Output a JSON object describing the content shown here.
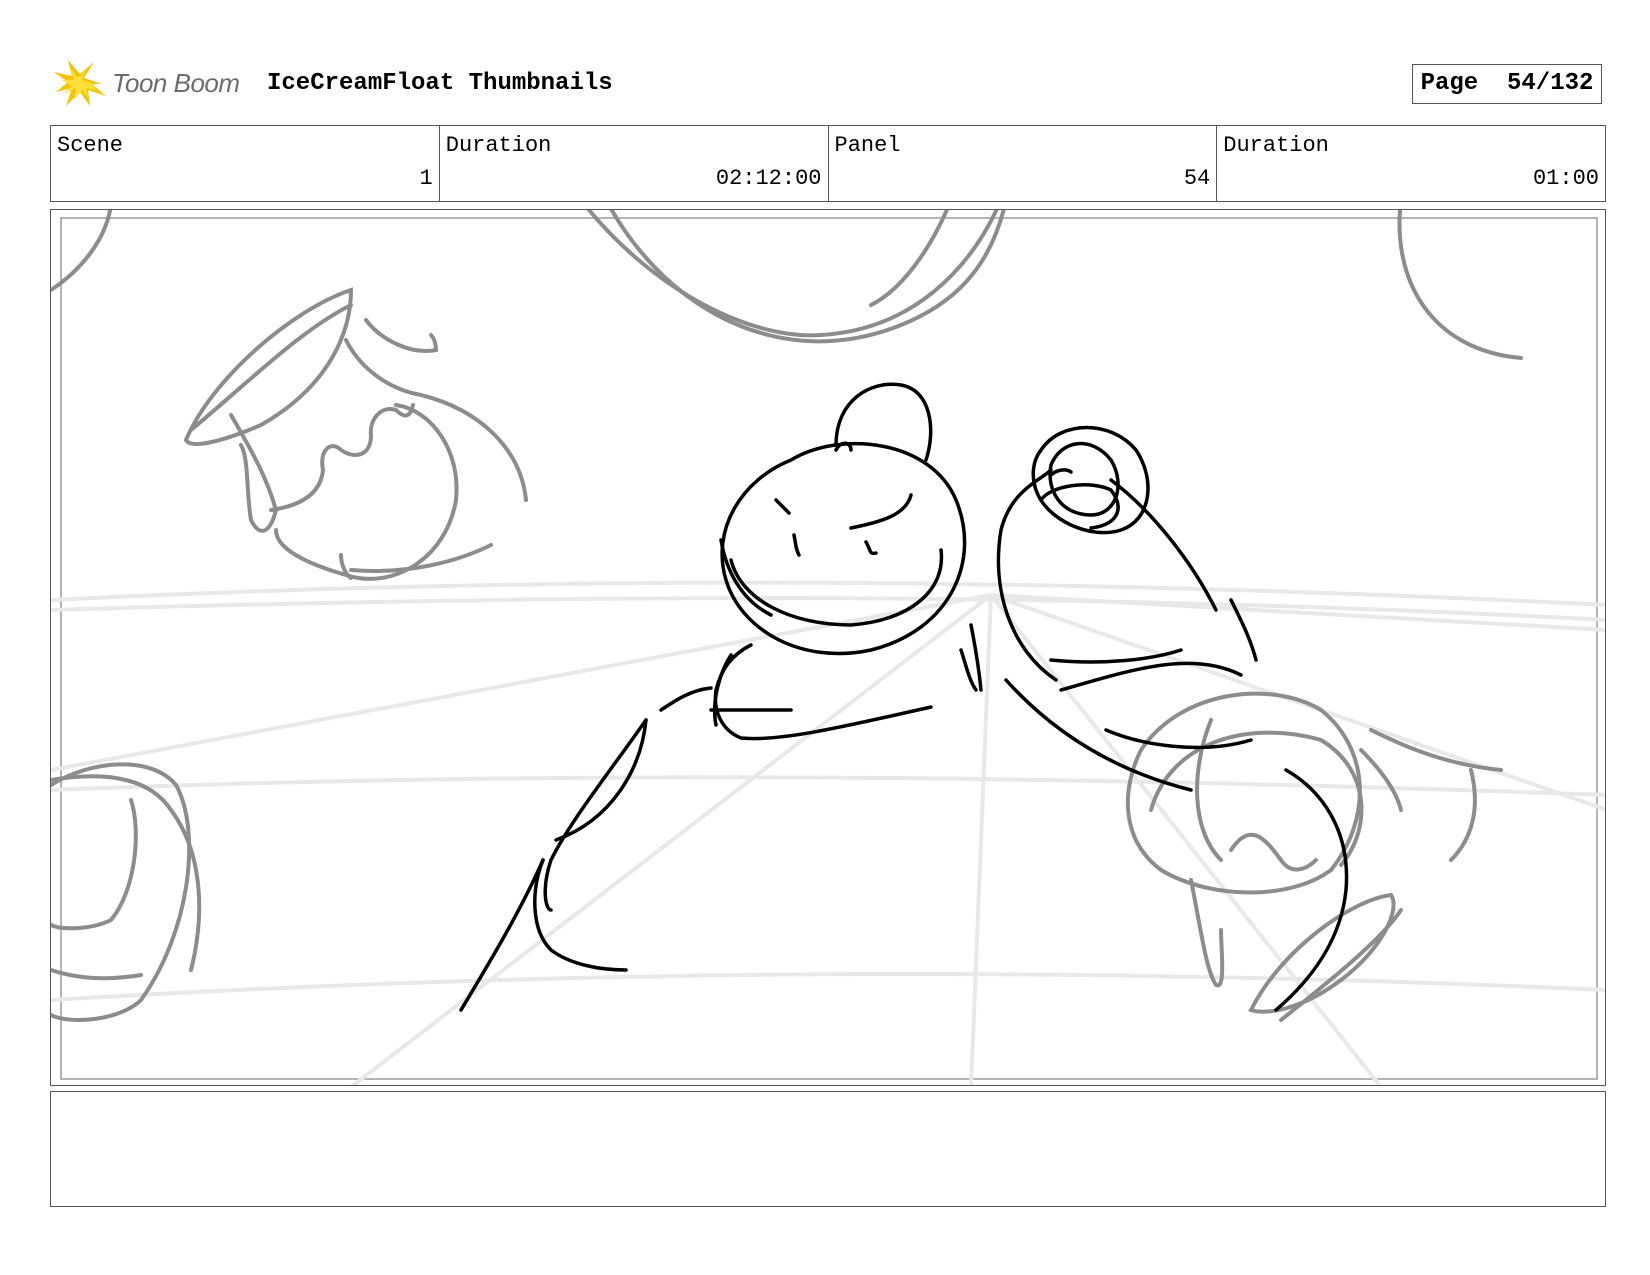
{
  "header": {
    "logo_text": "Toon Boom",
    "title": "IceCreamFloat Thumbnails",
    "page_label": "Page",
    "page_value": "54/132"
  },
  "info": {
    "scene_label": "Scene",
    "scene_value": "1",
    "scene_duration_label": "Duration",
    "scene_duration_value": "02:12:00",
    "panel_label": "Panel",
    "panel_value": "54",
    "panel_duration_label": "Duration",
    "panel_duration_value": "01:00"
  },
  "notes": {
    "text": ""
  },
  "colors": {
    "logo_star": "#f5c400",
    "sketch_dark": "#000000",
    "sketch_mid": "#8c8c8c",
    "sketch_light": "#e6e6e6"
  }
}
